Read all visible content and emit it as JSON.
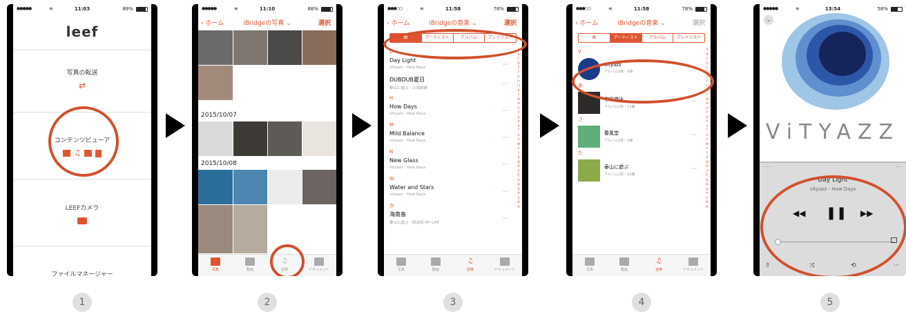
{
  "phones": [
    {
      "status": {
        "signal": "●●●●●",
        "time": "11:03",
        "battery": "89%"
      },
      "logo": "leef",
      "menu": [
        {
          "label": "写真の転送",
          "icon": "transfer-arrows-icon"
        },
        {
          "label": "コンテンツビューア",
          "icon": "content-type-icons"
        },
        {
          "label": "LEEFカメラ",
          "icon": "camera-icon"
        },
        {
          "label": "ファイルマネージャー",
          "icon": ""
        }
      ]
    },
    {
      "status": {
        "signal": "●●●●●",
        "time": "11:10",
        "battery": "88%"
      },
      "nav": {
        "back": "ホーム",
        "title": "iBridgeの写真",
        "action": "選択"
      },
      "dates": [
        "2015/10/07",
        "2015/10/08"
      ],
      "tabs": [
        "写真",
        "動画",
        "音楽",
        "ドキュメント"
      ]
    },
    {
      "status": {
        "signal": "●●●○○",
        "time": "11:58",
        "battery": "78%"
      },
      "nav": {
        "back": "ホーム",
        "title": "iBridgeの音楽",
        "action": "選択"
      },
      "segments": [
        "曲",
        "アーティスト",
        "アルバム",
        "プレイリスト"
      ],
      "sections": [
        {
          "letter": "D",
          "songs": [
            {
              "title": "Day Light",
              "sub": "vityazz - How Days"
            },
            {
              "title": "DUBDUB夏日",
              "sub": "泰山に遊ぶ - 上海旅游"
            }
          ]
        },
        {
          "letter": "H",
          "songs": [
            {
              "title": "How Days",
              "sub": "vityazz - How Days"
            }
          ]
        },
        {
          "letter": "M",
          "songs": [
            {
              "title": "Mild Balance",
              "sub": "vityazz - How Days"
            }
          ]
        },
        {
          "letter": "N",
          "songs": [
            {
              "title": "New Glass",
              "sub": "vityazz - How Days"
            }
          ]
        },
        {
          "letter": "W",
          "songs": [
            {
              "title": "Water and Stars",
              "sub": "vityazz - How Days"
            }
          ]
        },
        {
          "letter": "か",
          "songs": [
            {
              "title": "海南島",
              "sub": "泰山に遊ぶ - 四合院 MY LIFE"
            }
          ]
        }
      ],
      "index": "A B C D E F G H I J K L M N O P Q R S T U V W X Y Z あ か さ た な は ま や ら わ #",
      "more": "···",
      "tabs": [
        "写真",
        "動画",
        "音楽",
        "ドキュメント"
      ]
    },
    {
      "status": {
        "signal": "●●●○○",
        "time": "11:58",
        "battery": "78%"
      },
      "nav": {
        "back": "ホーム",
        "title": "iBridgeの音楽",
        "action": "選択"
      },
      "segments": [
        "曲",
        "アーティスト",
        "アルバム",
        "プレイリスト"
      ],
      "artists": [
        {
          "letter": "V",
          "name": "vityazz",
          "sub": "アルバム1枚・5曲"
        },
        {
          "letter": "あ",
          "name": "宇宙遊泳",
          "sub": "アルバム1枚・11曲"
        },
        {
          "letter": "さ",
          "name": "春風堂",
          "sub": "アルバム1枚・3曲"
        },
        {
          "letter": "た",
          "name": "泰山に遊ぶ",
          "sub": "アルバム2枚・16曲"
        }
      ],
      "more": "···",
      "tabs": [
        "写真",
        "動画",
        "音楽",
        "ドキュメント"
      ]
    },
    {
      "status": {
        "signal": "●●●●●",
        "time": "13:54",
        "battery": "58%"
      },
      "cover_text": "ViTYAZZ",
      "track": {
        "title": "Day Light",
        "sub": "vityazz - How Days"
      },
      "time_left": "--:--",
      "time_right": "--:--",
      "controls": [
        "rewind-icon",
        "pause-icon",
        "fast-forward-icon"
      ]
    }
  ],
  "steps": [
    "1",
    "2",
    "3",
    "4",
    "5"
  ],
  "colors": {
    "accent": "#e05530",
    "ring": "#d2502d"
  }
}
